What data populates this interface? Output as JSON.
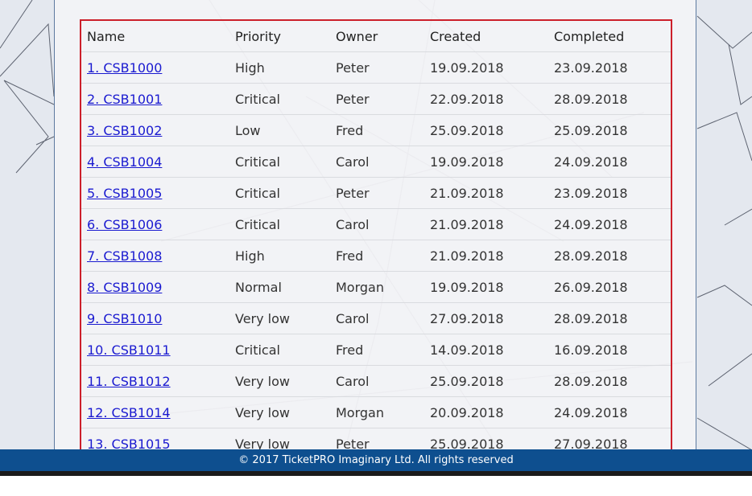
{
  "table": {
    "headers": [
      "Name",
      "Priority",
      "Owner",
      "Created",
      "Completed"
    ],
    "rows": [
      {
        "name": "1. CSB1000",
        "priority": "High",
        "owner": "Peter",
        "created": "19.09.2018",
        "completed": "23.09.2018"
      },
      {
        "name": "2. CSB1001",
        "priority": "Critical",
        "owner": "Peter",
        "created": "22.09.2018",
        "completed": "28.09.2018"
      },
      {
        "name": "3. CSB1002",
        "priority": "Low",
        "owner": "Fred",
        "created": "25.09.2018",
        "completed": "25.09.2018"
      },
      {
        "name": "4. CSB1004",
        "priority": "Critical",
        "owner": "Carol",
        "created": "19.09.2018",
        "completed": "24.09.2018"
      },
      {
        "name": "5. CSB1005",
        "priority": "Critical",
        "owner": "Peter",
        "created": "21.09.2018",
        "completed": "23.09.2018"
      },
      {
        "name": "6. CSB1006",
        "priority": "Critical",
        "owner": "Carol",
        "created": "21.09.2018",
        "completed": "24.09.2018"
      },
      {
        "name": "7. CSB1008",
        "priority": "High",
        "owner": "Fred",
        "created": "21.09.2018",
        "completed": "28.09.2018"
      },
      {
        "name": "8. CSB1009",
        "priority": "Normal",
        "owner": "Morgan",
        "created": "19.09.2018",
        "completed": "26.09.2018"
      },
      {
        "name": "9. CSB1010",
        "priority": "Very low",
        "owner": "Carol",
        "created": "27.09.2018",
        "completed": "28.09.2018"
      },
      {
        "name": "10. CSB1011",
        "priority": "Critical",
        "owner": "Fred",
        "created": "14.09.2018",
        "completed": "16.09.2018"
      },
      {
        "name": "11. CSB1012",
        "priority": "Very low",
        "owner": "Carol",
        "created": "25.09.2018",
        "completed": "28.09.2018"
      },
      {
        "name": "12. CSB1014",
        "priority": "Very low",
        "owner": "Morgan",
        "created": "20.09.2018",
        "completed": "24.09.2018"
      },
      {
        "name": "13. CSB1015",
        "priority": "Very low",
        "owner": "Peter",
        "created": "25.09.2018",
        "completed": "27.09.2018"
      }
    ]
  },
  "footer": {
    "copyright": "© 2017 TicketPRO Imaginary Ltd. All rights reserved"
  },
  "colors": {
    "highlight_border": "#cc1f2a",
    "link": "#1a1ad0",
    "footer_bg": "#0e4f8f"
  }
}
